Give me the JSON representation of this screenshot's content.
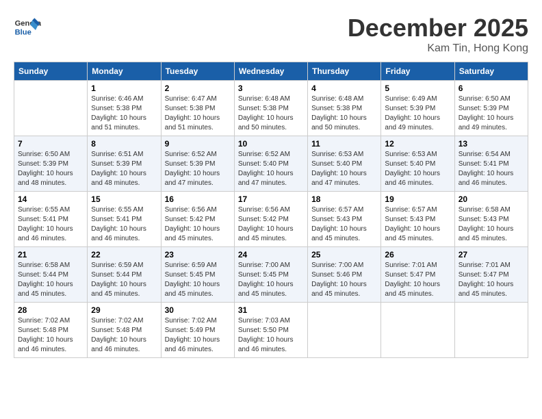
{
  "header": {
    "logo_text_general": "General",
    "logo_text_blue": "Blue",
    "month_title": "December 2025",
    "location": "Kam Tin, Hong Kong"
  },
  "calendar": {
    "days_of_week": [
      "Sunday",
      "Monday",
      "Tuesday",
      "Wednesday",
      "Thursday",
      "Friday",
      "Saturday"
    ],
    "weeks": [
      [
        {
          "day": "",
          "sunrise": "",
          "sunset": "",
          "daylight": ""
        },
        {
          "day": "1",
          "sunrise": "Sunrise: 6:46 AM",
          "sunset": "Sunset: 5:38 PM",
          "daylight": "Daylight: 10 hours and 51 minutes."
        },
        {
          "day": "2",
          "sunrise": "Sunrise: 6:47 AM",
          "sunset": "Sunset: 5:38 PM",
          "daylight": "Daylight: 10 hours and 51 minutes."
        },
        {
          "day": "3",
          "sunrise": "Sunrise: 6:48 AM",
          "sunset": "Sunset: 5:38 PM",
          "daylight": "Daylight: 10 hours and 50 minutes."
        },
        {
          "day": "4",
          "sunrise": "Sunrise: 6:48 AM",
          "sunset": "Sunset: 5:38 PM",
          "daylight": "Daylight: 10 hours and 50 minutes."
        },
        {
          "day": "5",
          "sunrise": "Sunrise: 6:49 AM",
          "sunset": "Sunset: 5:39 PM",
          "daylight": "Daylight: 10 hours and 49 minutes."
        },
        {
          "day": "6",
          "sunrise": "Sunrise: 6:50 AM",
          "sunset": "Sunset: 5:39 PM",
          "daylight": "Daylight: 10 hours and 49 minutes."
        }
      ],
      [
        {
          "day": "7",
          "sunrise": "Sunrise: 6:50 AM",
          "sunset": "Sunset: 5:39 PM",
          "daylight": "Daylight: 10 hours and 48 minutes."
        },
        {
          "day": "8",
          "sunrise": "Sunrise: 6:51 AM",
          "sunset": "Sunset: 5:39 PM",
          "daylight": "Daylight: 10 hours and 48 minutes."
        },
        {
          "day": "9",
          "sunrise": "Sunrise: 6:52 AM",
          "sunset": "Sunset: 5:39 PM",
          "daylight": "Daylight: 10 hours and 47 minutes."
        },
        {
          "day": "10",
          "sunrise": "Sunrise: 6:52 AM",
          "sunset": "Sunset: 5:40 PM",
          "daylight": "Daylight: 10 hours and 47 minutes."
        },
        {
          "day": "11",
          "sunrise": "Sunrise: 6:53 AM",
          "sunset": "Sunset: 5:40 PM",
          "daylight": "Daylight: 10 hours and 47 minutes."
        },
        {
          "day": "12",
          "sunrise": "Sunrise: 6:53 AM",
          "sunset": "Sunset: 5:40 PM",
          "daylight": "Daylight: 10 hours and 46 minutes."
        },
        {
          "day": "13",
          "sunrise": "Sunrise: 6:54 AM",
          "sunset": "Sunset: 5:41 PM",
          "daylight": "Daylight: 10 hours and 46 minutes."
        }
      ],
      [
        {
          "day": "14",
          "sunrise": "Sunrise: 6:55 AM",
          "sunset": "Sunset: 5:41 PM",
          "daylight": "Daylight: 10 hours and 46 minutes."
        },
        {
          "day": "15",
          "sunrise": "Sunrise: 6:55 AM",
          "sunset": "Sunset: 5:41 PM",
          "daylight": "Daylight: 10 hours and 46 minutes."
        },
        {
          "day": "16",
          "sunrise": "Sunrise: 6:56 AM",
          "sunset": "Sunset: 5:42 PM",
          "daylight": "Daylight: 10 hours and 45 minutes."
        },
        {
          "day": "17",
          "sunrise": "Sunrise: 6:56 AM",
          "sunset": "Sunset: 5:42 PM",
          "daylight": "Daylight: 10 hours and 45 minutes."
        },
        {
          "day": "18",
          "sunrise": "Sunrise: 6:57 AM",
          "sunset": "Sunset: 5:43 PM",
          "daylight": "Daylight: 10 hours and 45 minutes."
        },
        {
          "day": "19",
          "sunrise": "Sunrise: 6:57 AM",
          "sunset": "Sunset: 5:43 PM",
          "daylight": "Daylight: 10 hours and 45 minutes."
        },
        {
          "day": "20",
          "sunrise": "Sunrise: 6:58 AM",
          "sunset": "Sunset: 5:43 PM",
          "daylight": "Daylight: 10 hours and 45 minutes."
        }
      ],
      [
        {
          "day": "21",
          "sunrise": "Sunrise: 6:58 AM",
          "sunset": "Sunset: 5:44 PM",
          "daylight": "Daylight: 10 hours and 45 minutes."
        },
        {
          "day": "22",
          "sunrise": "Sunrise: 6:59 AM",
          "sunset": "Sunset: 5:44 PM",
          "daylight": "Daylight: 10 hours and 45 minutes."
        },
        {
          "day": "23",
          "sunrise": "Sunrise: 6:59 AM",
          "sunset": "Sunset: 5:45 PM",
          "daylight": "Daylight: 10 hours and 45 minutes."
        },
        {
          "day": "24",
          "sunrise": "Sunrise: 7:00 AM",
          "sunset": "Sunset: 5:45 PM",
          "daylight": "Daylight: 10 hours and 45 minutes."
        },
        {
          "day": "25",
          "sunrise": "Sunrise: 7:00 AM",
          "sunset": "Sunset: 5:46 PM",
          "daylight": "Daylight: 10 hours and 45 minutes."
        },
        {
          "day": "26",
          "sunrise": "Sunrise: 7:01 AM",
          "sunset": "Sunset: 5:47 PM",
          "daylight": "Daylight: 10 hours and 45 minutes."
        },
        {
          "day": "27",
          "sunrise": "Sunrise: 7:01 AM",
          "sunset": "Sunset: 5:47 PM",
          "daylight": "Daylight: 10 hours and 45 minutes."
        }
      ],
      [
        {
          "day": "28",
          "sunrise": "Sunrise: 7:02 AM",
          "sunset": "Sunset: 5:48 PM",
          "daylight": "Daylight: 10 hours and 46 minutes."
        },
        {
          "day": "29",
          "sunrise": "Sunrise: 7:02 AM",
          "sunset": "Sunset: 5:48 PM",
          "daylight": "Daylight: 10 hours and 46 minutes."
        },
        {
          "day": "30",
          "sunrise": "Sunrise: 7:02 AM",
          "sunset": "Sunset: 5:49 PM",
          "daylight": "Daylight: 10 hours and 46 minutes."
        },
        {
          "day": "31",
          "sunrise": "Sunrise: 7:03 AM",
          "sunset": "Sunset: 5:50 PM",
          "daylight": "Daylight: 10 hours and 46 minutes."
        },
        {
          "day": "",
          "sunrise": "",
          "sunset": "",
          "daylight": ""
        },
        {
          "day": "",
          "sunrise": "",
          "sunset": "",
          "daylight": ""
        },
        {
          "day": "",
          "sunrise": "",
          "sunset": "",
          "daylight": ""
        }
      ]
    ]
  }
}
